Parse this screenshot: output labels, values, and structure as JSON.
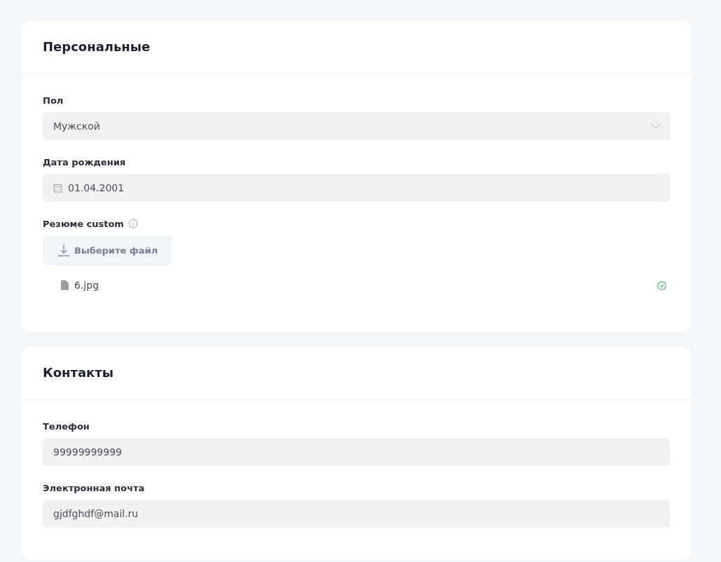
{
  "sections": [
    {
      "title": "Персональные",
      "fields": [
        {
          "kind": "select",
          "label": "Пол",
          "value": "Мужской"
        },
        {
          "kind": "date",
          "label": "Дата рождения",
          "value": "01.04.2001"
        },
        {
          "kind": "file",
          "label": "Резюме custom",
          "button": "Выберите файл",
          "files": [
            {
              "name": "6.jpg",
              "uploaded": true
            }
          ]
        }
      ]
    },
    {
      "title": "Контакты",
      "fields": [
        {
          "kind": "text",
          "label": "Телефон",
          "value": "99999999999"
        },
        {
          "kind": "text",
          "label": "Электронная почта",
          "value": "gjdfghdf@mail.ru"
        }
      ]
    }
  ]
}
